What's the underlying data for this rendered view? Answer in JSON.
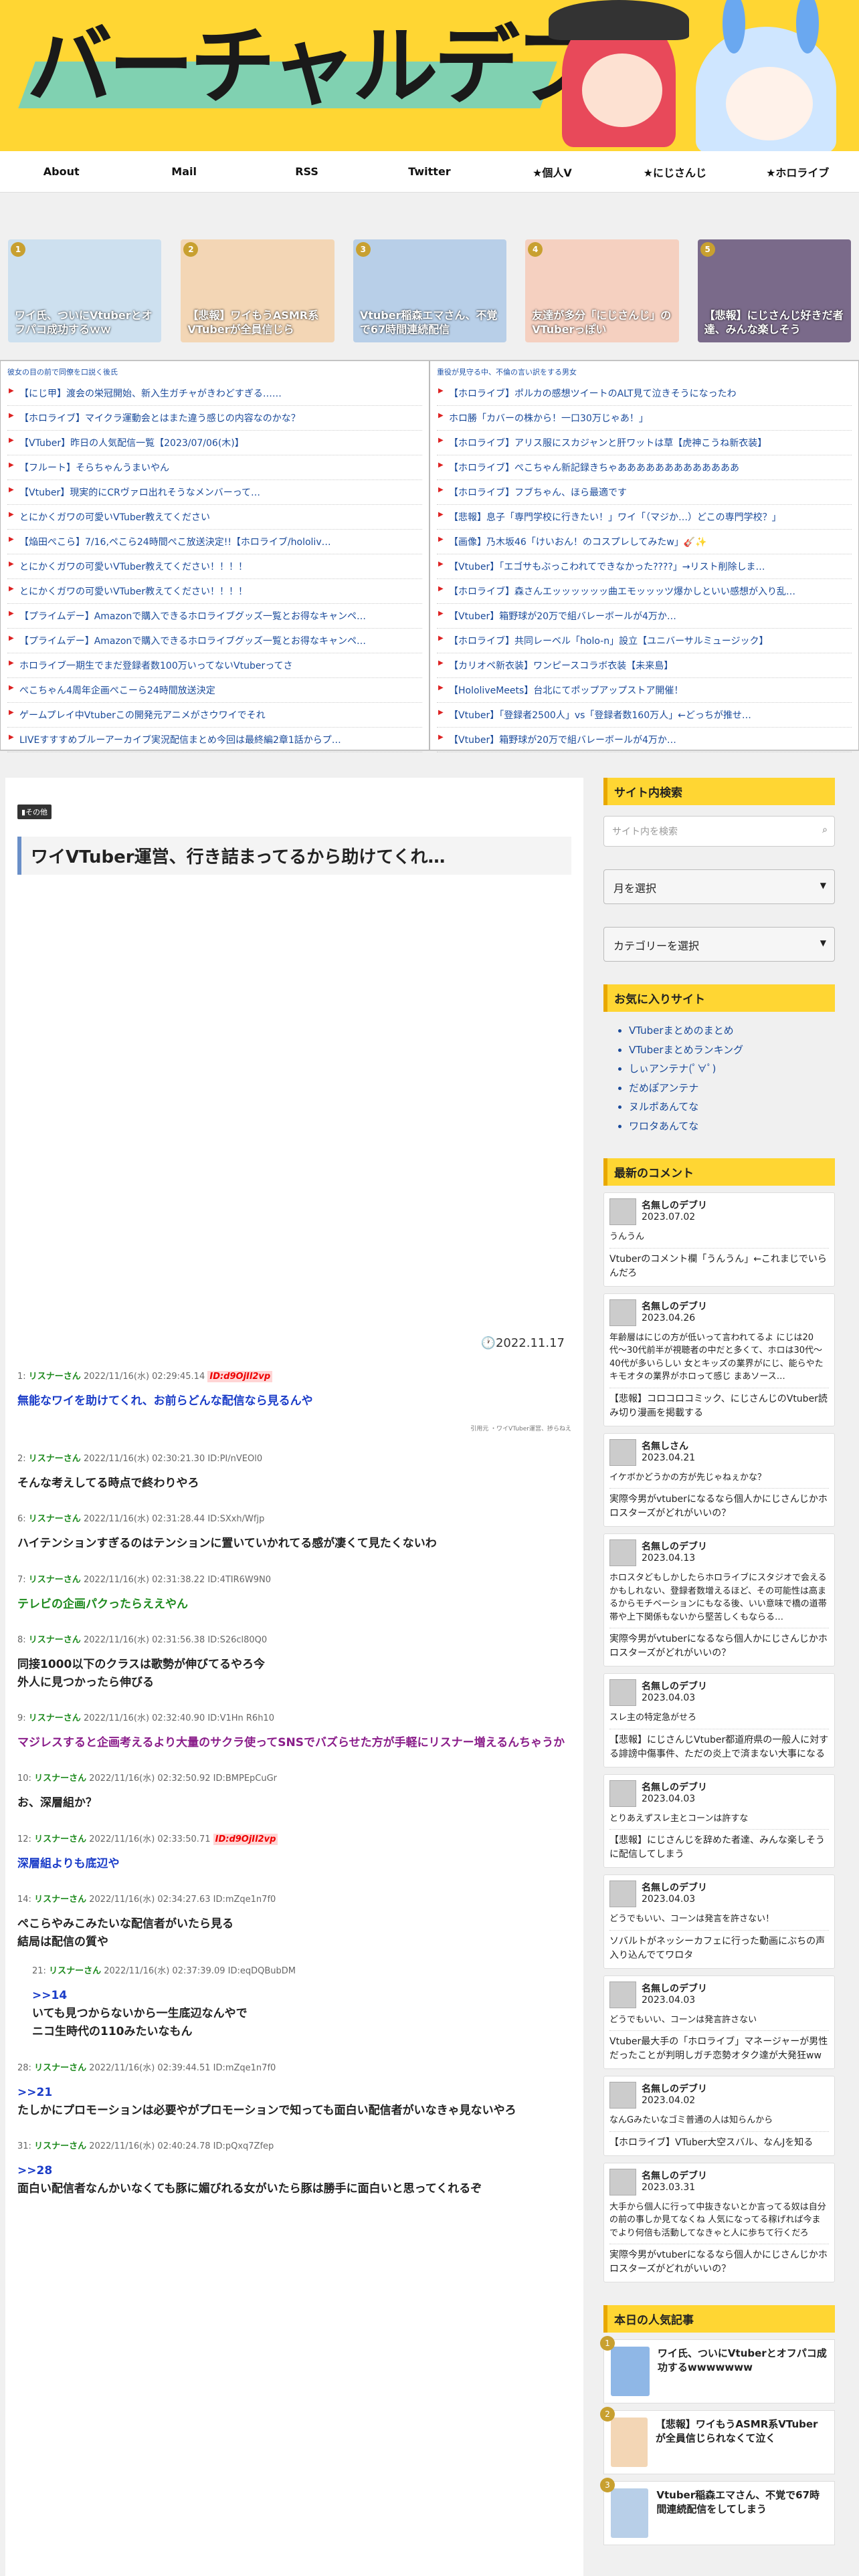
{
  "site": {
    "title": "バーチャルデブリ"
  },
  "nav": [
    "About",
    "Mail",
    "RSS",
    "Twitter",
    "★個人V",
    "★にじさんじ",
    "★ホロライブ"
  ],
  "thumbs": [
    {
      "num": "1",
      "caption": "ワイ氏、ついにVtuberとオフパコ成功するｗｗ"
    },
    {
      "num": "2",
      "caption": "【悲報】ワイもうASMR系VTuberが全員信じら"
    },
    {
      "num": "3",
      "caption": "Vtuber稲森エマさん、不覚で67時間連続配信"
    },
    {
      "num": "4",
      "caption": "友達が多分「にじさんじ」のVTuberっぽい"
    },
    {
      "num": "5",
      "caption": "【悲報】にじさんじ好きだ者達、みんな楽しそう"
    }
  ],
  "feed_left": {
    "sub": "彼女の目の前で同僚を口説く後氏",
    "items": [
      "【にじ甲】渡会の栄冠開始、新入生ガチャがきわどすぎる……",
      "【ホロライブ】マイクラ運動会とはまた違う感じの内容なのかな？",
      "【VTuber】昨日の人気配信一覧【2023/07/06(木)】",
      "【フルート】そらちゃんうまいやん",
      "【Vtuber】現実的にCRヴァロ出れそうなメンバーって…",
      "とにかくガワの可愛いVTuber教えてください",
      "【焔田ぺこら】7/16,ペこら24時間ぺこ放送決定!!【ホロライブ/hololiv…",
      "とにかくガワの可愛いVTuber教えてください！！！！",
      "とにかくガワの可愛いVTuber教えてください！！！！",
      "【プライムデー】Amazonで購入できるホロライブグッズ一覧とお得なキャンペ…",
      "【プライムデー】Amazonで購入できるホロライブグッズ一覧とお得なキャンペ…",
      "ホロライブ一期生でまだ登録者数100万いってないVtuberってさ",
      "ぺこちゃん4周年企画ぺこーら24時間放送決定",
      "ゲームプレイ中Vtuberこの開発元アニメがさウワイでそれ",
      "LIVEすすすめブルーアーカイブ実況配信まとめ今回は最終編2章1話からプ…"
    ]
  },
  "feed_right": {
    "sub": "重役が見守る中、不倫の言い訳をする男女",
    "items": [
      "【ホロライブ】ポルカの感想ツイートのALT見て泣きそうになったわ",
      "ホロ勝「カバーの株から！一口30万じゃあ！」",
      "【ホロライブ】アリス服にスカジャンと肝ワットは草【虎神こうね新衣装】",
      "【ホロライブ】ぺこちゃん新記録きちゃあああああああああああああ",
      "【ホロライブ】フブちゃん、ほら最適です",
      "【悲報】息子「専門学校に行きたい！」ワイ「（マジか…）どこの専門学校？」",
      "【画像】乃木坂46「けいおん！のコスプレしてみたw」🎸✨",
      "【Vtuber】「エゴサもぶっこわれてできなかった????」→リスト削除しま…",
      "【ホロライブ】森さんエッッッッッッ曲エモッッッツ爆かしといい感想が入り乱…",
      "【Vtuber】箱野球が20万で組バレーボールが4万か…",
      "【ホロライブ】共同レーベル「holo-n」設立【ユニバーサルミュージック】",
      "【カリオペ新衣装】ワンピースコラボ衣装【未来島】",
      "【HololiveMeets】台北にてポップアップストア開催！",
      "【Vtuber】「登録者2500人」vs「登録者数160万人」←どっちが推せ…",
      "【Vtuber】箱野球が20万で組バレーボールが4万か…"
    ]
  },
  "article": {
    "category": "その他",
    "title": "ワイVTuber運営、行き詰まってるから助けてくれ…",
    "date": "2022.11.17",
    "small_note": "引用元 ・ワイVTuber運営、捗らねえ",
    "posts": [
      {
        "no": "1:",
        "name": "リスナーさん",
        "meta": "2022/11/16(水) 02:29:45.14",
        "id": "ID:d9OjIl2vp",
        "hl": true,
        "body": "無能なワイを助けてくれ、お前らどんな配信なら見るんや",
        "color": "blue"
      },
      {
        "no": "2:",
        "name": "リスナーさん",
        "meta": "2022/11/16(水) 02:30:21.30 ID:PI/nVEOl0",
        "body": "そんな考えしてる時点で終わりやろ",
        "color": ""
      },
      {
        "no": "6:",
        "name": "リスナーさん",
        "meta": "2022/11/16(水) 02:31:28.44 ID:SXxh/Wfjp",
        "body": "ハイテンションすぎるのはテンションに置いていかれてる感が凄くて見たくないわ",
        "color": ""
      },
      {
        "no": "7:",
        "name": "リスナーさん",
        "meta": "2022/11/16(水) 02:31:38.22 ID:4TIR6W9N0",
        "body": "テレビの企画パクったらええやん",
        "color": "green"
      },
      {
        "no": "8:",
        "name": "リスナーさん",
        "meta": "2022/11/16(水) 02:31:56.38 ID:S26cl80Q0",
        "body": "同接1000以下のクラスは歌勢が伸びてるやろ今\n外人に見つかったら伸びる",
        "color": ""
      },
      {
        "no": "9:",
        "name": "リスナーさん",
        "meta": "2022/11/16(水) 02:32:40.90 ID:V1Hn R6h10",
        "body": "マジレスすると企画考えるより大量のサクラ使ってSNSでバズらせた方が手軽にリスナー増えるんちゃうか",
        "color": "purple"
      },
      {
        "no": "10:",
        "name": "リスナーさん",
        "meta": "2022/11/16(水) 02:32:50.92 ID:BMPEpCuGr",
        "body": "お、深層組か？",
        "color": ""
      },
      {
        "no": "12:",
        "name": "リスナーさん",
        "meta": "2022/11/16(水) 02:33:50.71",
        "id": "ID:d9OjIl2vp",
        "hl": true,
        "body": "深層組よりも底辺や",
        "color": "blue"
      },
      {
        "no": "14:",
        "name": "リスナーさん",
        "meta": "2022/11/16(水) 02:34:27.63 ID:mZqe1n7f0",
        "body": "ぺこらやみこみたいな配信者がいたら見る\n結局は配信の質や",
        "color": ""
      }
    ],
    "nested": {
      "no": "21:",
      "name": "リスナーさん",
      "meta": "2022/11/16(水) 02:37:39.09 ID:eqDQBubDM",
      "anchor": ">>14",
      "body": "いても見つからないから一生底辺なんやで\nニコ生時代の110みたいなもん"
    },
    "posts2": [
      {
        "no": "28:",
        "name": "リスナーさん",
        "meta": "2022/11/16(水) 02:39:44.51 ID:mZqe1n7f0",
        "anchor": ">>21",
        "body": "たしかにプロモーションは必要やがプロモーションで知っても面白い配信者がいなきゃ見ないやろ"
      },
      {
        "no": "31:",
        "name": "リスナーさん",
        "meta": "2022/11/16(水) 02:40:24.78 ID:pQxq7Zfep",
        "anchor": ">>28",
        "body": "面白い配信者なんかいなくても豚に媚びれる女がいたら豚は勝手に面白いと思ってくれるぞ"
      }
    ]
  },
  "sidebar": {
    "search_title": "サイト内検索",
    "search_placeholder": "サイト内を検索",
    "month_select": "月を選択",
    "category_select": "カテゴリーを選択",
    "fav_title": "お気に入りサイト",
    "favs": [
      "VTuberまとめのまとめ",
      "VTuberまとめランキング",
      "しぃアンテナ(ﾟ∀ﾟ)",
      "だめぽアンテナ",
      "ヌルポあんてな",
      "ワロタあんてな"
    ],
    "comments_title": "最新のコメント",
    "comments": [
      {
        "name": "名無しのデブリ",
        "date": "2023.07.02",
        "text": "うんうん",
        "article": "Vtuberのコメント欄「うんうん」←これまじでいらんだろ"
      },
      {
        "name": "名無しのデブリ",
        "date": "2023.04.26",
        "text": "年齢層はにじの方が低いって言われてるよ にじは20代〜30代前半が視聴者の中だと多くて、ホロは30代〜40代が多いらしい 女とキッズの業界がにじ、能らやたキモオタの業界がホロって感じ まあソース…",
        "article": "【悲報】コロコロコミック、にじさんじのVtuber読み切り漫画を掲載する"
      },
      {
        "name": "名無しさん",
        "date": "2023.04.21",
        "text": "イケボかどうかの方が先じゃねぇかな？",
        "article": "実際今男がvtuberになるなら個人かにじさんじかホロスターズがどれがいいの？"
      },
      {
        "name": "名無しのデブリ",
        "date": "2023.04.13",
        "text": "ホロスタどもしかしたらホロライブにスタジオで会えるかもしれない、登録者数增えるほど、その可能性は高まるからモチベーションにもなる後、いい意味で橋の道帯帯や上下関係もないから堅苦しくもならる…",
        "article": "実際今男がvtuberになるなら個人かにじさんじかホロスターズがどれがいいの？"
      },
      {
        "name": "名無しのデブリ",
        "date": "2023.04.03",
        "text": "スレ主の特定急がせろ",
        "article": "【悲報】にじさんじVtuber都道府県の一般人に対する誹謗中傷事件、ただの炎上で済まない大事になる"
      },
      {
        "name": "名無しのデブリ",
        "date": "2023.04.03",
        "text": "とりあえずスレ主とコーンは許すな",
        "article": "【悲報】にじさんじを辞めた者達、みんな楽しそうに配信してしまう"
      },
      {
        "name": "名無しのデブリ",
        "date": "2023.04.03",
        "text": "どうでもいい、コーンは発言を許さない！",
        "article": "ソバルトがネッシーカフェに行った動画にぶちの声入り込んでてワロタ"
      },
      {
        "name": "名無しのデブリ",
        "date": "2023.04.03",
        "text": "どうでもいい、コーンは発言許さない",
        "article": "Vtuber最大手の「ホロライブ」マネージャーが男性だったことが判明しガチ恋勢オタク達が大発狂ww"
      },
      {
        "name": "名無しのデブリ",
        "date": "2023.04.02",
        "text": "なんGみたいなゴミ普通の人は知らんから",
        "article": "【ホロライブ】VTuber大空スバル、なんJを知る"
      },
      {
        "name": "名無しのデブリ",
        "date": "2023.03.31",
        "text": "大手から個人に行って中抜きないとか言ってる奴は自分の前の事しか見てなくね 人気になってる稼げれば今までより何倍も活動してなきゃと人に歩ちて行くだろ",
        "article": "実際今男がvtuberになるなら個人かにじさんじかホロスターズがどれがいいの？"
      }
    ],
    "popular_title": "本日の人気記事",
    "popular": [
      {
        "num": "1",
        "text": "ワイ氏、ついにVtuberとオフパコ成功するwwwwwww"
      },
      {
        "num": "2",
        "text": "【悲報】ワイもうASMR系VTuberが全員信じられなくて泣く"
      },
      {
        "num": "3",
        "text": "Vtuber稲森エマさん、不覚で67時間連続配信をしてしまう"
      }
    ]
  }
}
